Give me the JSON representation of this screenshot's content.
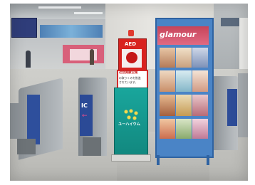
{
  "scene": {
    "aed_cabinet": {
      "heading": "AED"
    },
    "sign": {
      "line1": "社会貢献企業",
      "line2": "の取りくみを推進",
      "line3": "されています。"
    },
    "brand": {
      "name": "ユーハイウム"
    },
    "ic_marker": "IC",
    "magazine_rack": {
      "banner": "glamour"
    }
  }
}
